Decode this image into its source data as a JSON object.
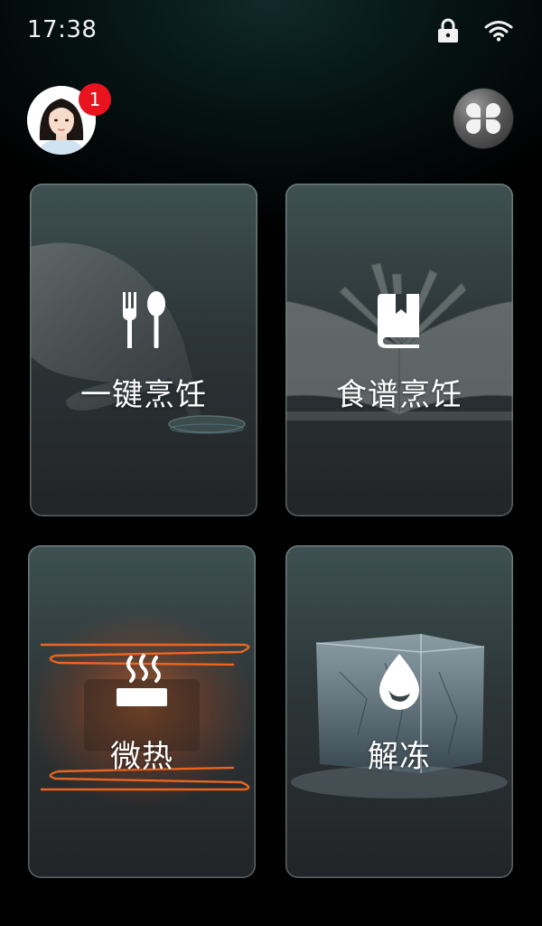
{
  "status_bar": {
    "time": "17:38",
    "icons": [
      "lock-icon",
      "wifi-icon"
    ]
  },
  "header": {
    "avatar": "user-avatar",
    "notification_count": "1",
    "apps_icon": "apps-grid-icon"
  },
  "cards": [
    {
      "label": "一键烹饪",
      "icon": "fork-spoon-icon",
      "background": "finger-pressing-button"
    },
    {
      "label": "食谱烹饪",
      "icon": "recipe-book-icon",
      "background": "open-book"
    },
    {
      "label": "微热",
      "icon": "steaming-dish-icon",
      "background": "heating-coil-oven"
    },
    {
      "label": "解冻",
      "icon": "water-drop-icon",
      "background": "ice-cube"
    }
  ],
  "colors": {
    "badge": "#e8131d",
    "heat_glow": "#ff6a1f",
    "card_top": "#3e5052",
    "card_bottom": "#222427"
  }
}
